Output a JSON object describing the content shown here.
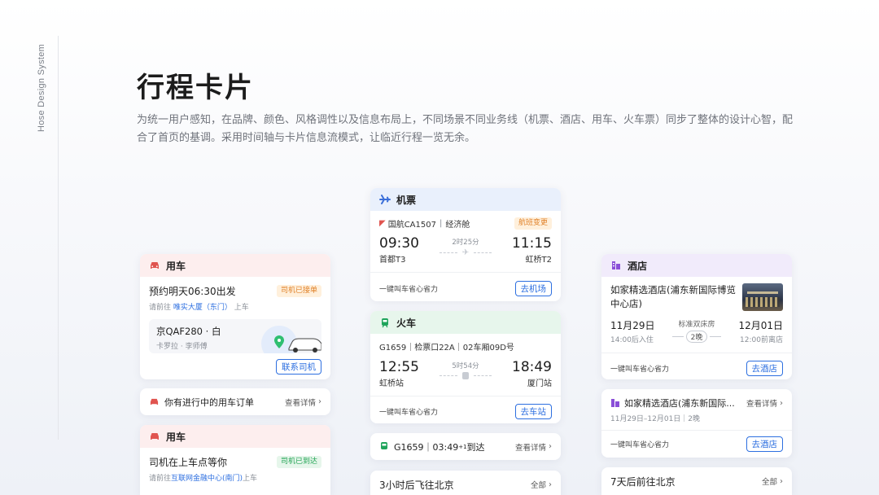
{
  "side_label": "Hose Design System",
  "page": {
    "title": "行程卡片",
    "intro": "为统一用户感知，在品牌、颜色、风格调性以及信息布局上，不同场景不同业务线（机票、酒店、用车、火车票）同步了整体的设计心智，配合了首页的基调。采用时间轴与卡片信息流模式，让临近行程一览无余。"
  },
  "colors": {
    "accent": "#2d6fe0",
    "car": "#e0544f",
    "train": "#1fa45b",
    "hotel": "#8a4fd8",
    "plane": "#3b6fd9"
  },
  "car_card": {
    "header": "用车",
    "title": "预约明天06:30出发",
    "badge": "司机已接单",
    "addr_prefix": "请前往",
    "addr": "唯实大厦（东门）",
    "addr_suffix": "上车",
    "plate": "京QAF280 · 白",
    "car_info": "卡罗拉 · 李师傅",
    "contact_btn": "联系司机"
  },
  "car_order": {
    "text": "你有进行中的用车订单",
    "link": "查看详情"
  },
  "car_card2": {
    "header": "用车",
    "title": "司机在上车点等你",
    "badge": "司机已到达",
    "addr_prefix": "请前往",
    "addr": "互联网金融中心(南门)",
    "addr_suffix": "上车"
  },
  "flight_card": {
    "header": "机票",
    "flight": "国航CA1507",
    "cabin": "经济舱",
    "badge": "航班变更",
    "dep_time": "09:30",
    "dep_place": "首都T3",
    "duration": "2时25分",
    "arr_time": "11:15",
    "arr_place": "虹桥T2",
    "footer_text": "一键叫车省心省力",
    "btn": "去机场"
  },
  "train_card": {
    "header": "火车",
    "info": "G1659｜检票口22A｜02车厢09D号",
    "dep_time": "12:55",
    "dep_place": "虹桥站",
    "duration": "5时54分",
    "arr_time": "18:49",
    "arr_place": "厦门站",
    "footer_text": "一键叫车省心省力",
    "btn": "去车站"
  },
  "train_compact": {
    "text": "G1659｜03:49",
    "sup": "+1",
    "suffix": " 到达",
    "link": "查看详情"
  },
  "flight_future": {
    "text": "3小时后飞往北京",
    "link": "全部"
  },
  "hotel_card": {
    "header": "酒店",
    "name": "如家精选酒店(浦东新国际博览中心店)",
    "checkin_date": "11月29日",
    "checkin_note": "14:00后入住",
    "room": "标准双床房",
    "nights": "2晚",
    "checkout_date": "12月01日",
    "checkout_note": "12:00前离店",
    "footer_text": "一键叫车省心省力",
    "btn": "去酒店"
  },
  "hotel_card2": {
    "name": "如家精选酒店(浦东新国际...",
    "link": "查看详情",
    "dates": "11月29日–12月01日｜2晚",
    "footer_text": "一键叫车省心省力",
    "btn": "去酒店"
  },
  "hotel_future": {
    "text": "7天后前往北京",
    "link": "全部"
  }
}
